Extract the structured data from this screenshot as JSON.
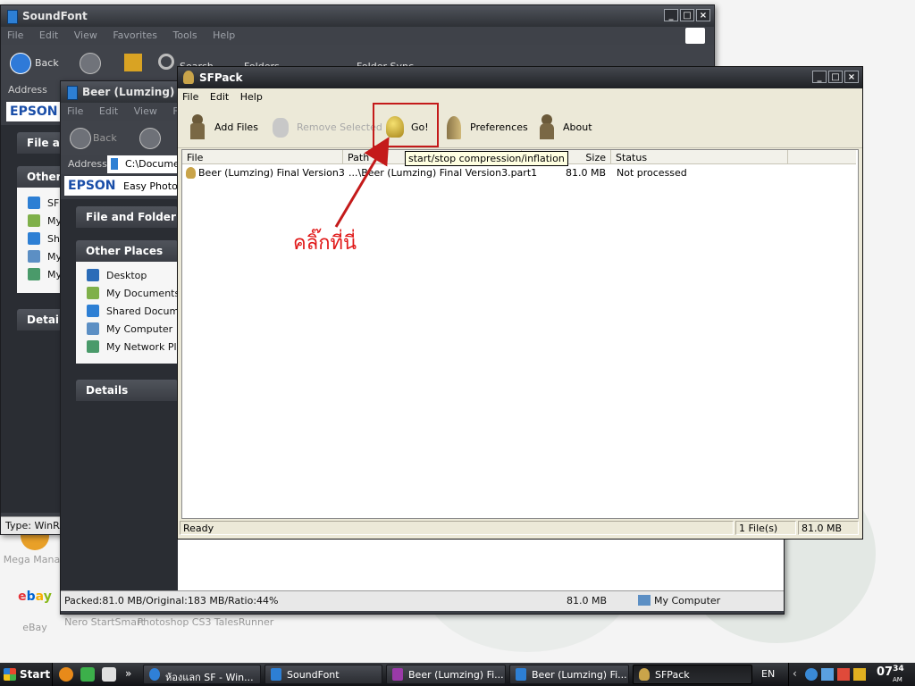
{
  "desktop": {
    "icons": [
      {
        "label": "Mega Manag",
        "color": "#e8a028"
      },
      {
        "label": "eBay",
        "color": "#d8d8d8"
      },
      {
        "label": "Nero StartSmart",
        "color": "#d0d0d0"
      },
      {
        "label": "Photoshop CS3",
        "color": "#d0d0d0"
      },
      {
        "label": "TalesRunner",
        "color": "#d0d0d0"
      }
    ]
  },
  "win_soundfont": {
    "title": "SoundFont",
    "menu": [
      "File",
      "Edit",
      "View",
      "Favorites",
      "Tools",
      "Help"
    ],
    "toolbar": {
      "back": "Back",
      "search": "Search",
      "folders": "Folders",
      "folder_sync": "Folder Sync"
    },
    "address_label": "Address",
    "brand": "EPSON",
    "panels": {
      "file_tasks": "File an",
      "other_places": "Other P",
      "details": "Details"
    },
    "places": [
      "SF",
      "My",
      "Sha",
      "My",
      "My"
    ],
    "status": "Type: WinRA"
  },
  "win_beer": {
    "title": "Beer (Lumzing) Fina",
    "menu": [
      "File",
      "Edit",
      "View",
      "Fa"
    ],
    "toolbar": {
      "back": "Back"
    },
    "address_label": "Address",
    "address_value": "C:\\Documen",
    "brand": "EPSON",
    "brand_sub": "Easy Photo P",
    "panels": {
      "file_tasks": "File and Folder Tas",
      "other_places": "Other Places",
      "details": "Details"
    },
    "places": [
      "Desktop",
      "My Documents",
      "Shared Documer",
      "My Computer",
      "My Network Plac"
    ],
    "status": {
      "info": "Packed:81.0 MB/Original:183 MB/Ratio:44%",
      "size": "81.0 MB",
      "location": "My Computer"
    }
  },
  "sfpack": {
    "title": "SFPack",
    "menu": [
      "File",
      "Edit",
      "Help"
    ],
    "toolbar": {
      "add_files": "Add Files",
      "remove_selected": "Remove Selected",
      "go": "Go!",
      "preferences": "Preferences",
      "about": "About"
    },
    "tooltip": "start/stop compression/inflation",
    "columns": [
      "File",
      "Path",
      "Size",
      "Status"
    ],
    "rows": [
      {
        "file": "Beer (Lumzing) Final Version3",
        "path": "...\\Beer (Lumzing) Final Version3.part1",
        "size": "81.0 MB",
        "status": "Not processed"
      }
    ],
    "status": {
      "text": "Ready",
      "count": "1 File(s)",
      "size": "81.0 MB"
    }
  },
  "annotation": {
    "text": "คลิ๊กที่นี่",
    "color": "#e01818"
  },
  "taskbar": {
    "start": "Start",
    "quicklaunch_more": "»",
    "tasks": [
      {
        "label": "ห้องแลก SF - Win..."
      },
      {
        "label": "SoundFont"
      },
      {
        "label": "Beer (Lumzing) Fi..."
      },
      {
        "label": "Beer (Lumzing) Fi..."
      },
      {
        "label": "SFPack"
      }
    ],
    "lang": "EN",
    "tray_arrow": "‹",
    "clock": "07",
    "clock_min": "34",
    "clock_ampm": "AM"
  },
  "colors": {
    "accent": "#c41a1a",
    "window_dark": "#3a3d44",
    "sfpack_bg": "#ece9d8"
  }
}
